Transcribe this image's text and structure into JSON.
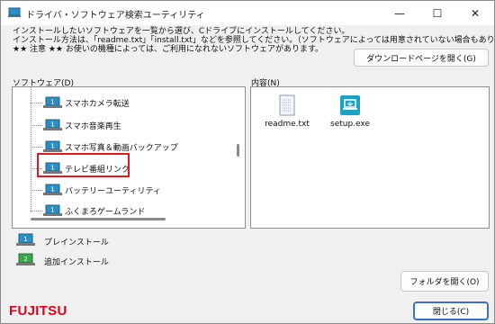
{
  "window": {
    "title": "ドライバ・ソフトウェア検索ユーティリティ",
    "minimize": "—",
    "maximize": "☐",
    "close": "✕"
  },
  "instructions": [
    "インストールしたいソフトウェアを一覧から選び、Cドライブにインストールしてください。",
    "インストール方法は、「readme.txt」「install.txt」などを参照してください。（ソフトウェアによっては用意されていない場合もあります）",
    "★★ 注意 ★★ お使いの機種によっては、ご利用になれないソフトウェアがあります。"
  ],
  "buttons": {
    "download": "ダウンロードページを開く(G)",
    "open_folder": "フォルダを開く(O)",
    "close": "閉じる(C)"
  },
  "software_label": "ソフトウェア(D)",
  "content_label": "内容(N)",
  "software_items": [
    {
      "label": "スマホカメラ転送",
      "selected": false
    },
    {
      "label": "スマホ音楽再生",
      "selected": false
    },
    {
      "label": "スマホ写真＆動画バックアップ",
      "selected": false
    },
    {
      "label": "テレビ番組リンク",
      "selected": true
    },
    {
      "label": "バッテリーユーティリティ",
      "selected": false
    },
    {
      "label": "ふくまろゲームランド",
      "selected": false
    }
  ],
  "files": [
    {
      "name": "readme.txt",
      "icon": "text-file-icon"
    },
    {
      "name": "setup.exe",
      "icon": "installer-icon"
    }
  ],
  "legend": [
    {
      "text": "プレインストール",
      "badge": "1",
      "color": "#2a8fc6"
    },
    {
      "text": "追加インストール",
      "badge": "2",
      "color": "#3aa64a"
    }
  ],
  "brand": "FUJITSU",
  "colors": {
    "highlight": "#e0191d",
    "brand": "#e2001a",
    "preinstall_icon": "#2a8fc6",
    "addinstall_icon": "#3aa64a",
    "setup_icon": "#1ba3c6"
  }
}
